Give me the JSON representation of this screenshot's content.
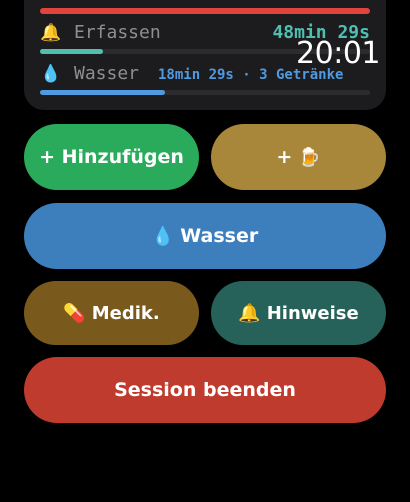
{
  "clock": "20:01",
  "colors": {
    "red": "#e0443c",
    "green": "#2aab5c",
    "gold": "#a8863a",
    "blue": "#3d7fbd",
    "brown": "#7a5a1c",
    "teal": "#266259",
    "session_red": "#bf3b2d",
    "teal_text": "#4fbfb0",
    "blue_text": "#4f9ae0"
  },
  "status": {
    "erfassen": {
      "icon": "bell-icon",
      "glyph": "🔔",
      "label": "Erfassen",
      "value": "48min 29s",
      "progress": 0.19
    },
    "wasser": {
      "icon": "water-drop-icon",
      "glyph": "💧",
      "label": "Wasser",
      "value": "18min 29s · 3 Getränke",
      "progress": 0.38
    }
  },
  "buttons": {
    "add_label": "+ Hinzufügen",
    "add_drink_prefix": "+",
    "add_drink_glyph": "🍺",
    "water_glyph": "💧",
    "water_label": "Wasser",
    "medik_glyph": "💊",
    "medik_label": "Medik.",
    "hints_glyph": "🔔",
    "hints_label": "Hinweise",
    "end_session_label": "Session beenden"
  }
}
